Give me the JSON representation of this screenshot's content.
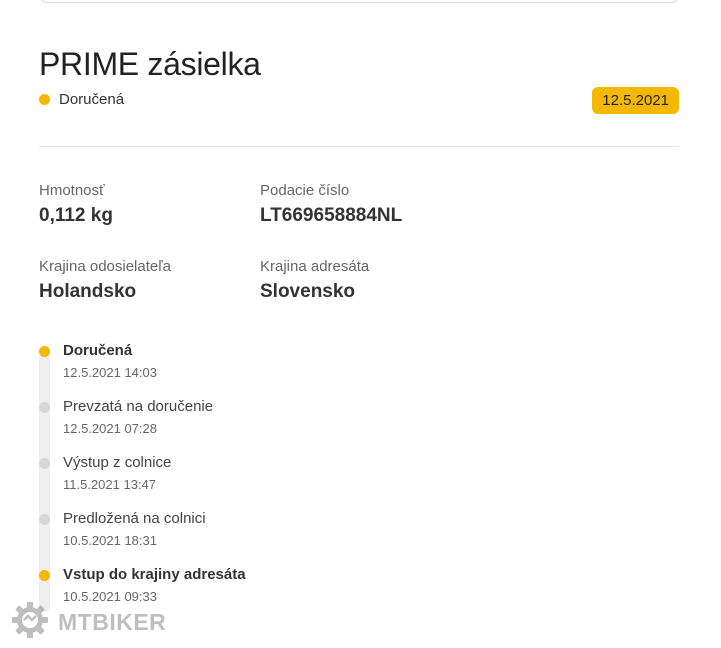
{
  "header": {
    "title": "PRIME zásielka",
    "status": "Doručená",
    "date_badge": "12.5.2021"
  },
  "colors": {
    "accent": "#f5b800",
    "inactive_dot": "#d6d6d6"
  },
  "details": {
    "weight_label": "Hmotnosť",
    "weight_value": "0,112 kg",
    "tracking_label": "Podacie číslo",
    "tracking_value": "LT669658884NL",
    "sender_country_label": "Krajina odosielateľa",
    "sender_country_value": "Holandsko",
    "recipient_country_label": "Krajina adresáta",
    "recipient_country_value": "Slovensko"
  },
  "timeline": [
    {
      "name": "Doručená",
      "time": "12.5.2021 14:03",
      "active": true
    },
    {
      "name": "Prevzatá na doručenie",
      "time": "12.5.2021 07:28",
      "active": false
    },
    {
      "name": "Výstup z colnice",
      "time": "11.5.2021 13:47",
      "active": false
    },
    {
      "name": "Predložená na colnici",
      "time": "10.5.2021 18:31",
      "active": false
    },
    {
      "name": "Vstup do krajiny adresáta",
      "time": "10.5.2021 09:33",
      "active": true
    }
  ],
  "watermark": {
    "icon": "gear-icon",
    "text": "MTBIKER"
  }
}
